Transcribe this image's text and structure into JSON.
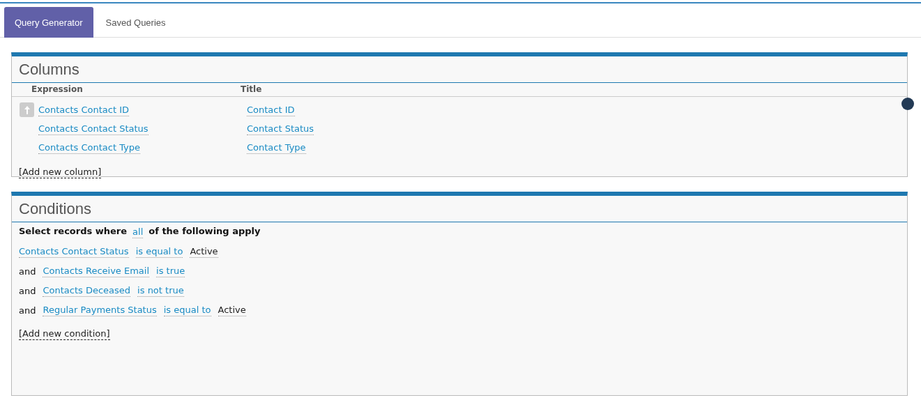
{
  "tabs": [
    {
      "label": "Query Generator",
      "selected": true
    },
    {
      "label": "Saved Queries",
      "selected": false
    }
  ],
  "columns_panel": {
    "title": "Columns",
    "headers": [
      "Expression",
      "Title"
    ],
    "rows": [
      {
        "expression": "Contacts Contact ID",
        "title": "Contact ID",
        "move_up": true
      },
      {
        "expression": "Contacts Contact Status",
        "title": "Contact Status",
        "move_up": false
      },
      {
        "expression": "Contacts Contact Type",
        "title": "Contact Type",
        "move_up": false
      }
    ],
    "add_link": "[Add new column]"
  },
  "conditions_panel": {
    "title": "Conditions",
    "intro_before": "Select records where",
    "match": "all",
    "intro_after": "of the following apply",
    "rows": [
      {
        "connector": "",
        "field": "Contacts Contact Status",
        "operator": "is equal to",
        "value": "Active"
      },
      {
        "connector": "and",
        "field": "Contacts Receive Email",
        "operator": "is true",
        "value": ""
      },
      {
        "connector": "and",
        "field": "Contacts Deceased",
        "operator": "is not true",
        "value": ""
      },
      {
        "connector": "and",
        "field": "Regular Payments Status",
        "operator": "is equal to",
        "value": "Active"
      }
    ],
    "add_link": "[Add new condition]"
  }
}
